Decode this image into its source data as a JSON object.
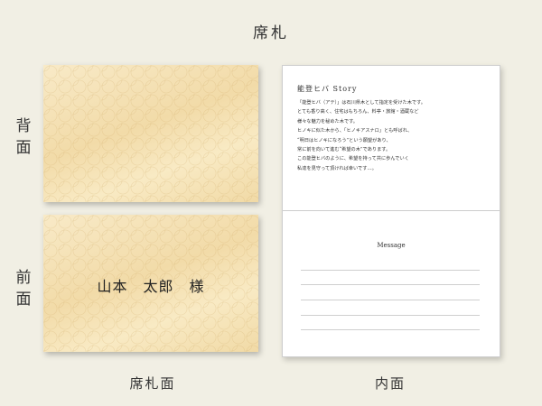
{
  "page_title": "席札",
  "side_labels": {
    "back": [
      "背",
      "面"
    ],
    "front": [
      "前",
      "面"
    ]
  },
  "front_card": {
    "name": "山本　太郎　様"
  },
  "inner_card": {
    "story_title": "能登ヒバ Story",
    "story_lines": [
      "「能登ヒバ（アテ）」は石川県木として指定を受けた木です。",
      "とても香り高く、住宅はもちろん、料亭・旅館・酒蔵など",
      "様々な魅力を秘めた木です。",
      "ヒノキに似た木から、「ヒノキアスナロ」とも呼ばれ、",
      "“明日はヒノキになろう”という願望があり、",
      "常に前を向いて進む“希望の木”であります。",
      "この能登ヒバのように、希望を持って共に歩んでいく",
      "私達を見守って頂ければ幸いです…。"
    ],
    "message_label": "Message"
  },
  "bottom_labels": {
    "left": "席札面",
    "right": "内面"
  }
}
